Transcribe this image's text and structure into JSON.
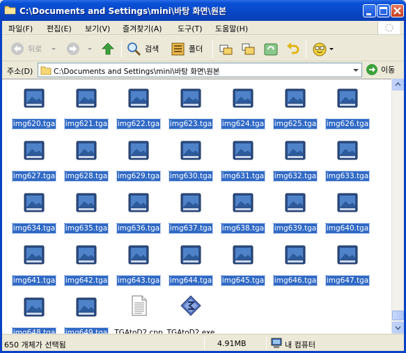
{
  "window": {
    "title": "C:\\Documents and Settings\\mini\\바탕 화면\\원본"
  },
  "menu": {
    "items": [
      "파일(F)",
      "편집(E)",
      "보기(V)",
      "즐겨찾기(A)",
      "도구(T)",
      "도움말(H)"
    ]
  },
  "toolbar": {
    "back_label": "뒤로",
    "search_label": "검색",
    "folders_label": "폴더"
  },
  "address": {
    "label": "주소(D)",
    "value": "C:\\Documents and Settings\\mini\\바탕 화면\\원본",
    "go_label": "이동"
  },
  "files": [
    {
      "name": "img620.tga",
      "type": "tga",
      "selected": true
    },
    {
      "name": "img621.tga",
      "type": "tga",
      "selected": true
    },
    {
      "name": "img622.tga",
      "type": "tga",
      "selected": true
    },
    {
      "name": "img623.tga",
      "type": "tga",
      "selected": true
    },
    {
      "name": "img624.tga",
      "type": "tga",
      "selected": true
    },
    {
      "name": "img625.tga",
      "type": "tga",
      "selected": true
    },
    {
      "name": "img626.tga",
      "type": "tga",
      "selected": true
    },
    {
      "name": "img627.tga",
      "type": "tga",
      "selected": true
    },
    {
      "name": "img628.tga",
      "type": "tga",
      "selected": true
    },
    {
      "name": "img629.tga",
      "type": "tga",
      "selected": true
    },
    {
      "name": "img630.tga",
      "type": "tga",
      "selected": true
    },
    {
      "name": "img631.tga",
      "type": "tga",
      "selected": true
    },
    {
      "name": "img632.tga",
      "type": "tga",
      "selected": true
    },
    {
      "name": "img633.tga",
      "type": "tga",
      "selected": true
    },
    {
      "name": "img634.tga",
      "type": "tga",
      "selected": true
    },
    {
      "name": "img635.tga",
      "type": "tga",
      "selected": true
    },
    {
      "name": "img636.tga",
      "type": "tga",
      "selected": true
    },
    {
      "name": "img637.tga",
      "type": "tga",
      "selected": true
    },
    {
      "name": "img638.tga",
      "type": "tga",
      "selected": true
    },
    {
      "name": "img639.tga",
      "type": "tga",
      "selected": true
    },
    {
      "name": "img640.tga",
      "type": "tga",
      "selected": true
    },
    {
      "name": "img641.tga",
      "type": "tga",
      "selected": true
    },
    {
      "name": "img642.tga",
      "type": "tga",
      "selected": true
    },
    {
      "name": "img643.tga",
      "type": "tga",
      "selected": true
    },
    {
      "name": "img644.tga",
      "type": "tga",
      "selected": true
    },
    {
      "name": "img645.tga",
      "type": "tga",
      "selected": true
    },
    {
      "name": "img646.tga",
      "type": "tga",
      "selected": true
    },
    {
      "name": "img647.tga",
      "type": "tga",
      "selected": true
    },
    {
      "name": "img648.tga",
      "type": "tga",
      "selected": true
    },
    {
      "name": "img649.tga",
      "type": "tga",
      "selected": true
    },
    {
      "name": "TGAtoD2.cpp",
      "type": "cpp",
      "selected": false
    },
    {
      "name": "TGAtoD2.exe",
      "type": "exe",
      "selected": false
    }
  ],
  "status": {
    "selection": "650 개체가 선택됨",
    "size": "4.91MB",
    "zone": "내 컴퓨터"
  },
  "colors": {
    "titlebar": "#0a52d6",
    "selection": "#316ac5",
    "content_bg": "#ffffff",
    "chrome": "#ece9d8"
  }
}
